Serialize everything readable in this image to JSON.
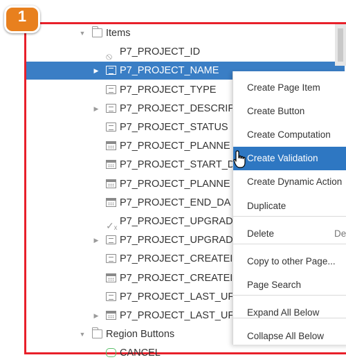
{
  "callout": {
    "number": "1"
  },
  "tree": [
    {
      "label": "Items",
      "icon": "folder-icon",
      "twisty": "▼",
      "indent": 0
    },
    {
      "label": "P7_PROJECT_ID",
      "icon": "hidden-item-icon",
      "twisty": "",
      "indent": 1
    },
    {
      "label": "P7_PROJECT_NAME",
      "icon": "select-list-icon",
      "twisty": "▶",
      "indent": 1,
      "selected": true
    },
    {
      "label": "P7_PROJECT_TYPE",
      "icon": "text-field-icon",
      "twisty": "",
      "indent": 1
    },
    {
      "label": "P7_PROJECT_DESCRIP",
      "icon": "text-field-icon",
      "twisty": "▶",
      "indent": 1
    },
    {
      "label": "P7_PROJECT_STATUS",
      "icon": "text-field-icon",
      "twisty": "",
      "indent": 1
    },
    {
      "label": "P7_PROJECT_PLANNE",
      "icon": "date-picker-icon",
      "twisty": "",
      "indent": 1
    },
    {
      "label": "P7_PROJECT_START_D",
      "icon": "date-picker-icon",
      "twisty": "",
      "indent": 1
    },
    {
      "label": "P7_PROJECT_PLANNE",
      "icon": "date-picker-icon",
      "twisty": "",
      "indent": 1
    },
    {
      "label": "P7_PROJECT_END_DA",
      "icon": "date-picker-icon",
      "twisty": "",
      "indent": 1
    },
    {
      "label": "P7_PROJECT_UPGRAD",
      "icon": "checkbox-item-icon",
      "twisty": "",
      "indent": 1
    },
    {
      "label": "P7_PROJECT_UPGRAD",
      "icon": "text-field-icon",
      "twisty": "▶",
      "indent": 1
    },
    {
      "label": "P7_PROJECT_CREATEI",
      "icon": "text-field-icon",
      "twisty": "",
      "indent": 1
    },
    {
      "label": "P7_PROJECT_CREATEI",
      "icon": "date-picker-icon",
      "twisty": "",
      "indent": 1
    },
    {
      "label": "P7_PROJECT_LAST_UF",
      "icon": "text-field-icon",
      "twisty": "",
      "indent": 1
    },
    {
      "label": "P7_PROJECT_LAST_UF",
      "icon": "date-picker-icon",
      "twisty": "▶",
      "indent": 1
    },
    {
      "label": "Region Buttons",
      "icon": "folder-icon",
      "twisty": "▼",
      "indent": 0
    },
    {
      "label": "CANCEL",
      "icon": "button-icon",
      "twisty": "",
      "indent": 1
    }
  ],
  "context_menu": {
    "items": [
      {
        "label": "Create Page Item",
        "shortcut": ""
      },
      {
        "label": "Create Button",
        "shortcut": ""
      },
      {
        "label": "Create Computation",
        "shortcut": ""
      },
      {
        "label": "Create Validation",
        "shortcut": "",
        "highlighted": true
      },
      {
        "label": "Create Dynamic Action",
        "shortcut": ""
      },
      {
        "label": "Duplicate",
        "shortcut": ""
      },
      {
        "label": "Delete",
        "shortcut": "Del"
      },
      {
        "label": "Copy to other Page...",
        "shortcut": ""
      },
      {
        "label": "Page Search",
        "shortcut": ""
      },
      {
        "label": "Expand All Below",
        "shortcut": ""
      },
      {
        "label": "Collapse All Below",
        "shortcut": ""
      }
    ]
  },
  "colors": {
    "frame": "#e8202a",
    "callout": "#e8801e",
    "selection": "#3a7ec5",
    "menu_highlight": "#2e77c2"
  }
}
